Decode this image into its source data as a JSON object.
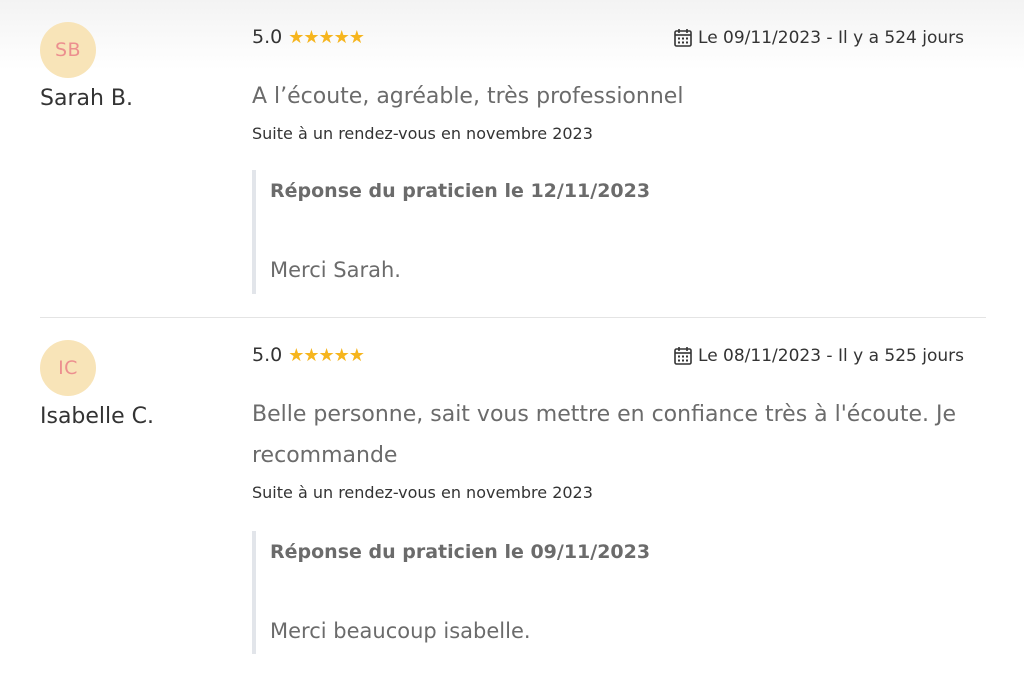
{
  "colors": {
    "avatar_bg": "#f8e4b8",
    "avatar_text": "#ec8f8f",
    "star": "#f6b51e",
    "muted_text": "#6b6b6b",
    "reply_border": "#e2e5ea"
  },
  "reviews": [
    {
      "initials": "SB",
      "author": "Sarah B.",
      "score": "5.0",
      "stars": "★★★★★",
      "rating": 5,
      "date": "Le 09/11/2023 - Il y a 524 jours",
      "comment": "A l’écoute, agréable, très professionnel",
      "visit": "Suite à un rendez-vous en novembre 2023",
      "reply_title": "Réponse du praticien le 12/11/2023",
      "reply_text": "Merci Sarah."
    },
    {
      "initials": "IC",
      "author": "Isabelle C.",
      "score": "5.0",
      "stars": "★★★★★",
      "rating": 5,
      "date": "Le 08/11/2023 - Il y a 525 jours",
      "comment": "Belle personne, sait vous mettre en confiance très à l'écoute. Je recommande",
      "visit": "Suite à un rendez-vous en novembre 2023",
      "reply_title": "Réponse du praticien le 09/11/2023",
      "reply_text": "Merci beaucoup isabelle."
    }
  ],
  "icons": {
    "calendar": "calendar-icon",
    "star": "star-icon"
  }
}
